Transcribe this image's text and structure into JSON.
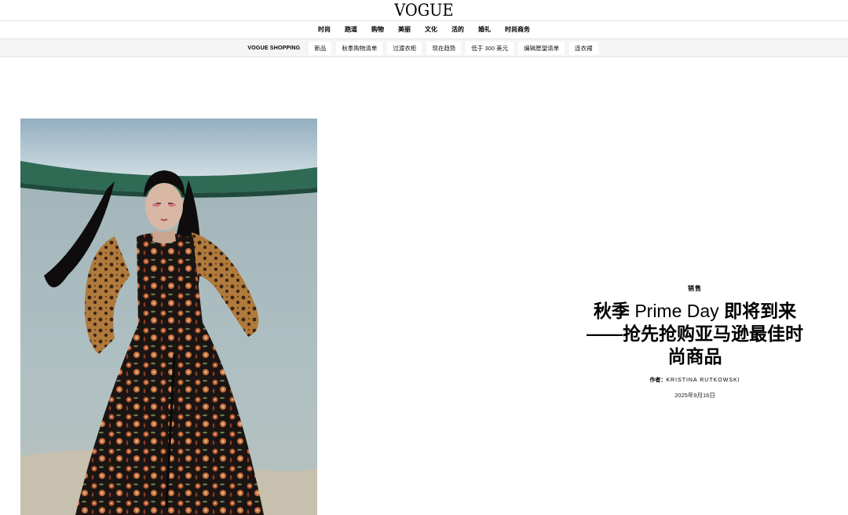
{
  "brand": {
    "logo": "VOGUE"
  },
  "nav": {
    "items": [
      "时尚",
      "跑道",
      "购物",
      "美丽",
      "文化",
      "活的",
      "婚礼",
      "时尚商务"
    ]
  },
  "shopping": {
    "label": "VOGUE SHOPPING",
    "chips": [
      "新品",
      "秋季购物清单",
      "过渡衣柜",
      "现在趋势",
      "低于 300 美元",
      "编辑愿望清单",
      "连衣裙"
    ]
  },
  "article": {
    "category": "销售",
    "title_prefix": "秋季",
    "title_brand": "Prime Day",
    "title_rest": "即将到来——抢先抢购亚马逊最佳时尚商品",
    "byline_label": "作者：",
    "author": "KRISTINA RUTKOWSKI",
    "date": "2025年9月16日"
  },
  "colors": {
    "shop_bar_bg": "#f5f5f5",
    "text": "#000000"
  }
}
